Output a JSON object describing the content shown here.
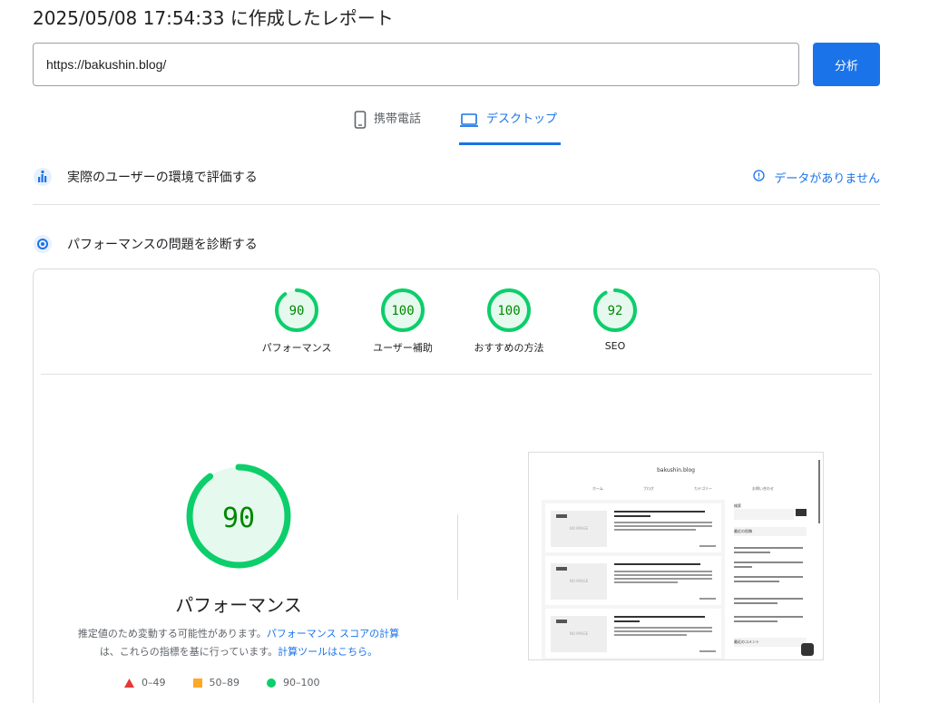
{
  "report_title": "2025/05/08 17:54:33 に作成したレポート",
  "url_input": {
    "value": "https://bakushin.blog/"
  },
  "analyze_button": "分析",
  "tabs": [
    {
      "label": "携帯電話",
      "icon": "smartphone-icon",
      "selected": false
    },
    {
      "label": "デスクトップ",
      "icon": "laptop-icon",
      "selected": true
    }
  ],
  "field_section": {
    "label": "実際のユーザーの環境で評価する",
    "no_data": "データがありません"
  },
  "diagnose_section": {
    "label": "パフォーマンスの問題を診断する"
  },
  "scores": [
    {
      "value": 90,
      "label": "パフォーマンス"
    },
    {
      "value": 100,
      "label": "ユーザー補助"
    },
    {
      "value": 100,
      "label": "おすすめの方法"
    },
    {
      "value": 92,
      "label": "SEO"
    }
  ],
  "main_score": {
    "value": 90,
    "label": "パフォーマンス"
  },
  "note": {
    "text1": "推定値のため変動する可能性があります。",
    "link1": "パフォーマンス スコアの計算",
    "text2": "は、これらの指標を基に行っています。",
    "link2": "計算ツールはこちら。"
  },
  "legend": [
    {
      "range": "0–49",
      "color": "#e53935",
      "shape": "triangle"
    },
    {
      "range": "50–89",
      "color": "#ffa726",
      "shape": "square"
    },
    {
      "range": "90–100",
      "color": "#0cce6b",
      "shape": "circle"
    }
  ],
  "colors": {
    "accent": "#1a73e8",
    "pass": "#0cce6b",
    "pass_text": "#008800",
    "pass_fill": "#e6f9ee"
  },
  "thumbnail": {
    "site_title": "bakushin.blog",
    "nav": [
      "ホーム",
      "ブログ",
      "カテゴリー",
      "お問い合わせ"
    ],
    "sidebar_search": "検索",
    "sidebar_recent": "最近の投稿",
    "sidebar_comments": "最近のコメント",
    "no_image": "NO IMAGE"
  }
}
